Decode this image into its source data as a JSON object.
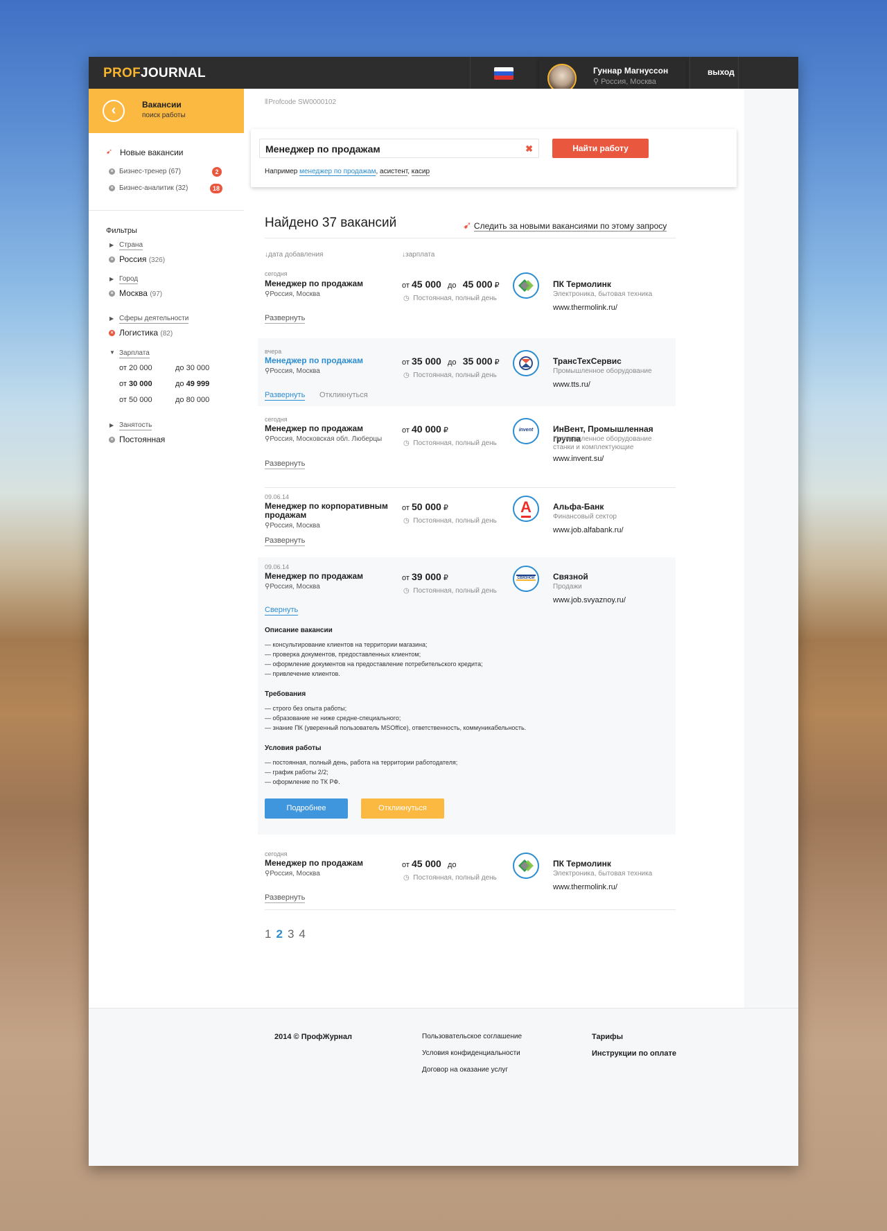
{
  "app": {
    "logo_a": "PROF",
    "logo_b": "JOURNAL"
  },
  "header": {
    "user_name": "Гуннар Магнуссон",
    "user_location": "Россия, Москва",
    "more": "•••",
    "logout": "выход"
  },
  "sidebar": {
    "section_title": "Вакансии",
    "section_sub": "поиск работы",
    "new_vacancies": "Новые вакансии",
    "subscriptions": [
      {
        "label": "Бизнес-тренер (67)",
        "badge": "2"
      },
      {
        "label": "Бизнес-аналитик (32)",
        "badge": "18"
      }
    ],
    "filters_title": "Фильтры",
    "country_label": "Страна",
    "country_value": "Россия",
    "country_count": "(326)",
    "city_label": "Город",
    "city_value": "Москва",
    "city_count": "(97)",
    "sphere_label": "Сферы деятельности",
    "sphere_value": "Логистика",
    "sphere_count": "(82)",
    "salary_label": "Зарплата",
    "salary_ranges": [
      {
        "from_prefix": "от",
        "from": "20 000",
        "to_prefix": "до",
        "to": "30 000"
      },
      {
        "from_prefix": "от",
        "from": "30 000",
        "to_prefix": "до",
        "to": "49 999"
      },
      {
        "from_prefix": "от",
        "from": "50 000",
        "to_prefix": "до",
        "to": "80 000"
      }
    ],
    "employment_label": "Занятость",
    "employment_value": "Постоянная"
  },
  "profcode": "Profcode SW0000102",
  "search": {
    "value": "Менеджер по продажам",
    "clear": "✖",
    "button": "Найти работу",
    "hint_prefix": "Например",
    "hint_1": "менеджер по продажам",
    "hint_2": "асистент",
    "hint_3": "касир",
    "comma": ","
  },
  "results": {
    "found": "Найдено 37 вакансий",
    "follow": "Следить за новыми вакансиями по этому запросу",
    "col_date": "дата добавления",
    "col_salary": "зарплата"
  },
  "jobs": [
    {
      "date": "сегодня",
      "title": "Менеджер по продажам",
      "location": "Россия, Москва",
      "from": "от",
      "salary_from": "45 000",
      "to": "до",
      "salary_to": "45 000",
      "currency": "₽",
      "schedule": "Постоянная, полный день",
      "company": "ПК Термолинк",
      "sector": "Электроника, бытовая техника",
      "url": "www.thermolink.ru/",
      "expand": "Развернуть"
    },
    {
      "date": "вчера",
      "title": "Менеджер по продажам",
      "location": "Россия, Москва",
      "from": "от",
      "salary_from": "35 000",
      "to": "до",
      "salary_to": "35 000",
      "currency": "₽",
      "schedule": "Постоянная, полный день",
      "company": "ТрансТехСервис",
      "sector": "Промышленное оборудование",
      "url": "www.tts.ru/",
      "expand": "Развернуть",
      "respond": "Откликнуться"
    },
    {
      "date": "сегодня",
      "title": "Менеджер по продажам",
      "location": "Россия, Московская обл. Люберцы",
      "from": "от",
      "salary_from": "40 000",
      "currency": "₽",
      "schedule": "Постоянная, полный день",
      "company": "ИнВент, Промышленная группа",
      "sector": "Промышленное оборудование станки и комплектующие",
      "url": "www.invent.su/",
      "expand": "Развернуть",
      "logo_text": "invent"
    },
    {
      "date": "09.06.14",
      "title": "Менеджер по корпоративным продажам",
      "location": "Россия, Москва",
      "from": "от",
      "salary_from": "50 000",
      "currency": "₽",
      "schedule": "Постоянная, полный день",
      "company": "Альфа-Банк",
      "sector": "Финансовый сектор",
      "url": "www.job.alfabank.ru/",
      "expand": "Развернуть",
      "logo_text": "А"
    },
    {
      "date": "09.06.14",
      "title": "Менеджер по продажам",
      "location": "Россия, Москва",
      "from": "от",
      "salary_from": "39 000",
      "currency": "₽",
      "schedule": "Постоянная, полный день",
      "company": "Связной",
      "sector": "Продажи",
      "url": "www.job.svyaznoy.ru/",
      "collapse": "Свернуть",
      "logo_text": "СВЯЗНОЙ"
    },
    {
      "date": "сегодня",
      "title": "Менеджер по продажам",
      "location": "Россия, Москва",
      "from": "от",
      "salary_from": "45 000",
      "to": "до",
      "currency": "₽",
      "schedule": "Постоянная, полный день",
      "company": "ПК Термолинк",
      "sector": "Электроника, бытовая техника",
      "url": "www.thermolink.ru/",
      "expand": "Развернуть"
    }
  ],
  "details": {
    "desc_title": "Описание вакансии",
    "desc": [
      "— консультирование клиентов на территории магазина;",
      "— проверка документов, предоставленных клиентом;",
      "— оформление документов на предоставление потребительского кредита;",
      "— привлечение клиентов."
    ],
    "req_title": "Требования",
    "req": [
      "— строго без опыта работы;",
      "— образование не ниже средне-специального;",
      "— знание ПК (уверенный пользователь MSOffice), ответственность, коммуникабельность."
    ],
    "cond_title": "Условия работы",
    "cond": [
      "— постоянная, полный день, работа на территории работодателя;",
      "— график работы 2/2;",
      "— оформление по ТК РФ."
    ],
    "more_button": "Подробнее",
    "respond_button": "Откликнуться"
  },
  "pagination": {
    "pages": [
      "1",
      "2",
      "3",
      "4"
    ],
    "current": "2"
  },
  "footer": {
    "copyright": "2014 © ПрофЖурнал",
    "links": [
      "Пользовательское соглашение",
      "Условия конфиденциальности",
      "Договор на оказание услуг"
    ],
    "bold_links": [
      "Тарифы",
      "Инструкции по оплате"
    ]
  },
  "colors": {
    "accent_yellow": "#fcb941",
    "accent_red": "#e9573f",
    "link_blue": "#2c8dd0",
    "topbar": "#2d2d2d"
  },
  "icons": {
    "back": "chevron-left-icon",
    "rocket": "rocket-icon",
    "pin": "map-pin-icon",
    "clock": "clock-icon",
    "remove": "remove-icon",
    "flag": "russia-flag-icon",
    "sort": "sort-icon"
  }
}
